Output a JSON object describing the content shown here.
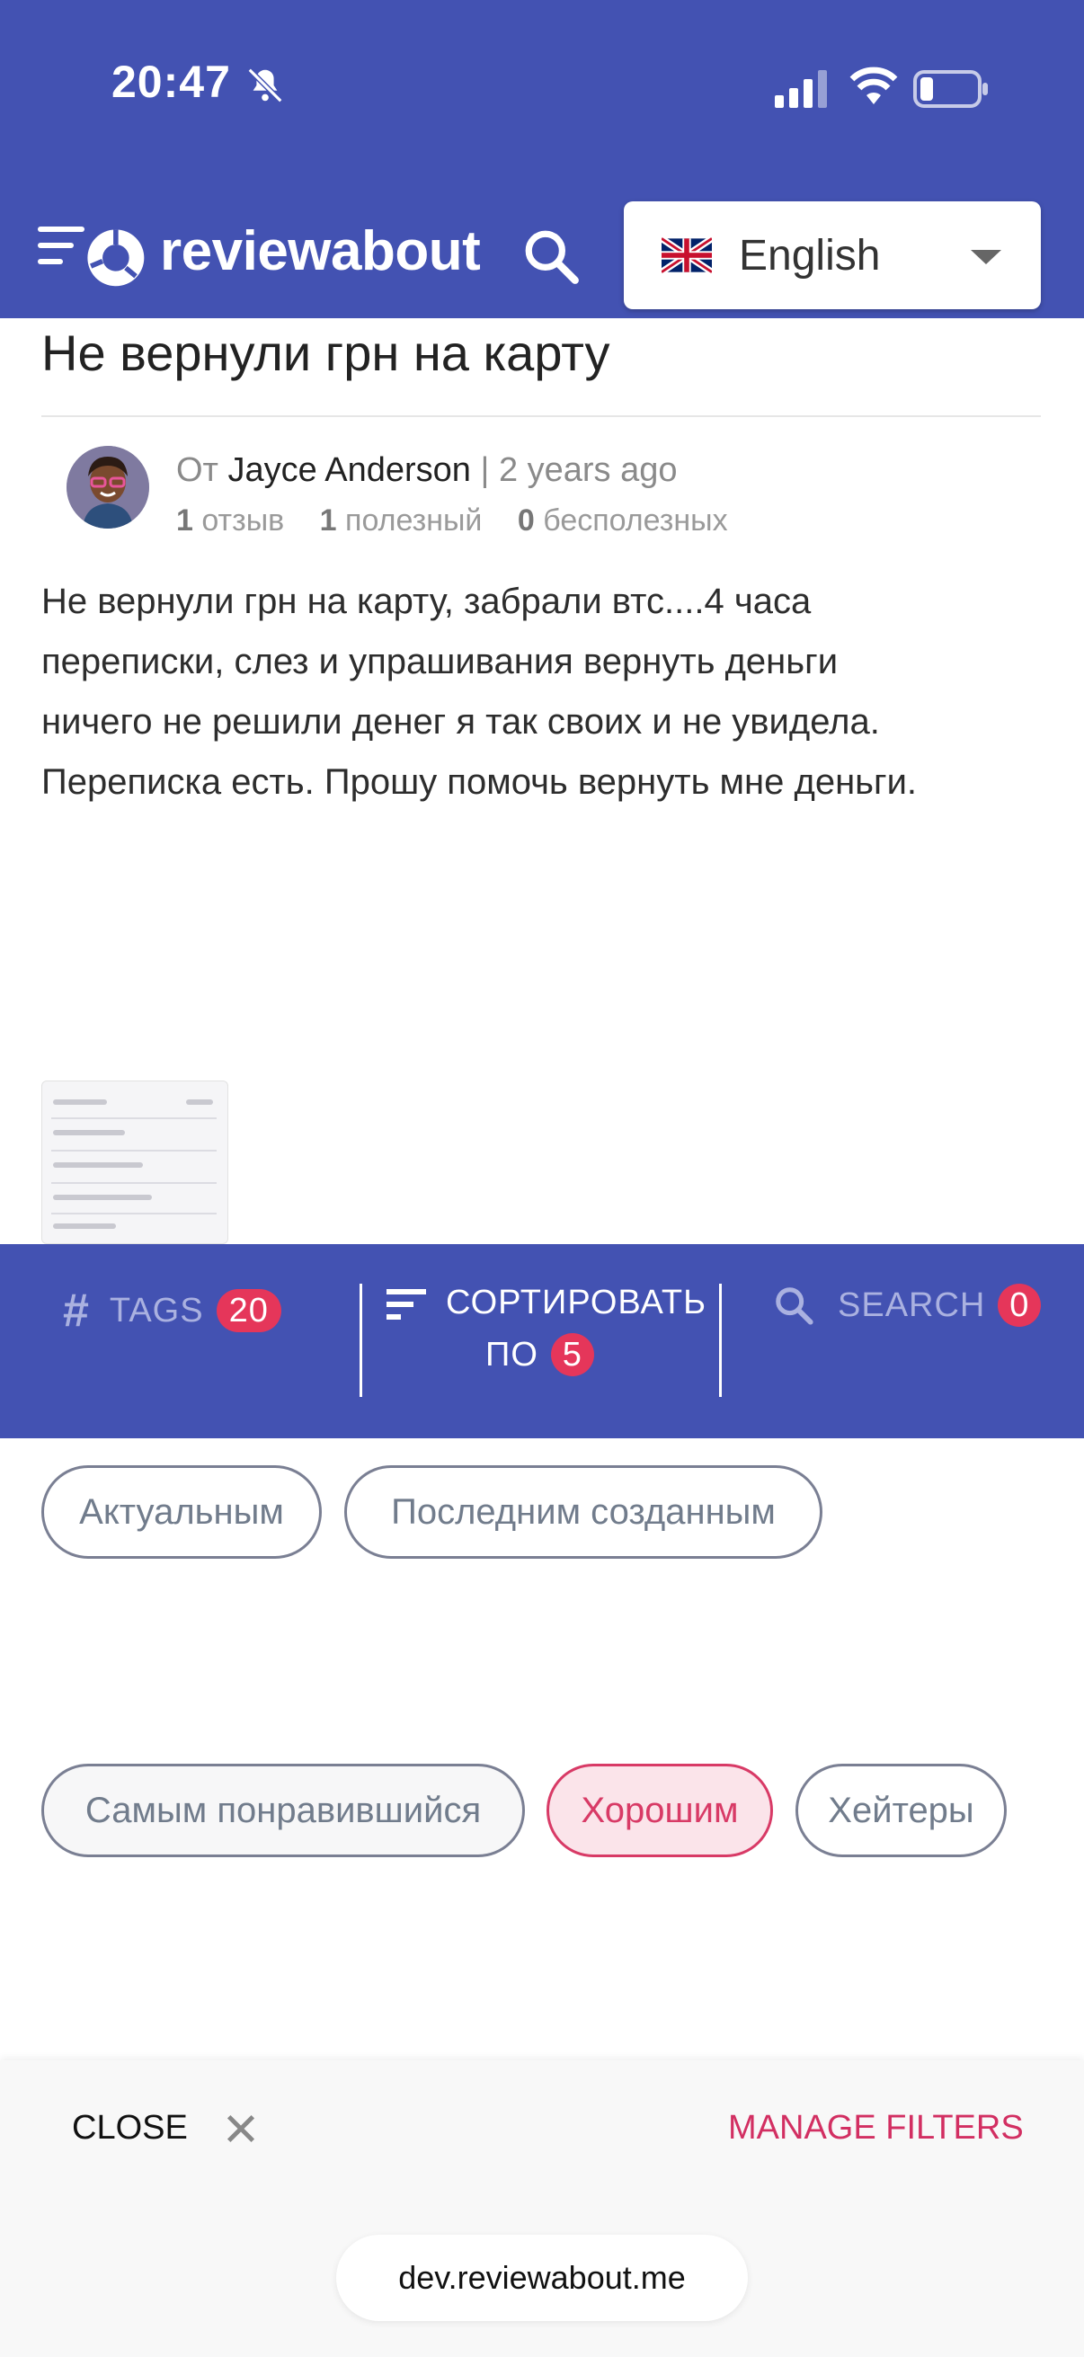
{
  "status_bar": {
    "time": "20:47"
  },
  "header": {
    "logo_text": "reviewabout",
    "language": "English"
  },
  "review": {
    "title": "Не вернули грн на карту",
    "by_label": "От",
    "author": "Jayce Anderson",
    "separator": "|",
    "time_ago": "2 years ago",
    "stats": {
      "reviews_count": "1",
      "reviews_label": "отзыв",
      "useful_count": "1",
      "useful_label": "полезный",
      "useless_count": "0",
      "useless_label": "бесполезных"
    },
    "body_lines": [
      "Не вернули грн на карту, забрали втс....4 часа",
      "переписки, слез и упрашивания вернуть деньги",
      "ничего не решили денег я так своих и не увидела.",
      "Переписка есть. Прошу помочь вернуть мне деньги."
    ]
  },
  "filter_bar": {
    "tags_label": "TAGS",
    "tags_count": "20",
    "sort_label_line1": "СОРТИРОВАТЬ",
    "sort_label_line2": "ПО",
    "sort_count": "5",
    "search_label": "SEARCH",
    "search_count": "0"
  },
  "sort_options": [
    {
      "label": "Актуальным",
      "active": false
    },
    {
      "label": "Последним созданным",
      "active": false
    },
    {
      "label": "Самым понравившийся",
      "active": false
    },
    {
      "label": "Хорошим",
      "active": true
    },
    {
      "label": "Хейтеры",
      "active": false
    }
  ],
  "bottom": {
    "close_label": "CLOSE",
    "manage_label": "MANAGE FILTERS",
    "url": "dev.reviewabout.me"
  },
  "colors": {
    "primary": "#4352b2",
    "badge": "#e5365a",
    "active_chip": "#d83a66",
    "manage": "#d22f62"
  }
}
